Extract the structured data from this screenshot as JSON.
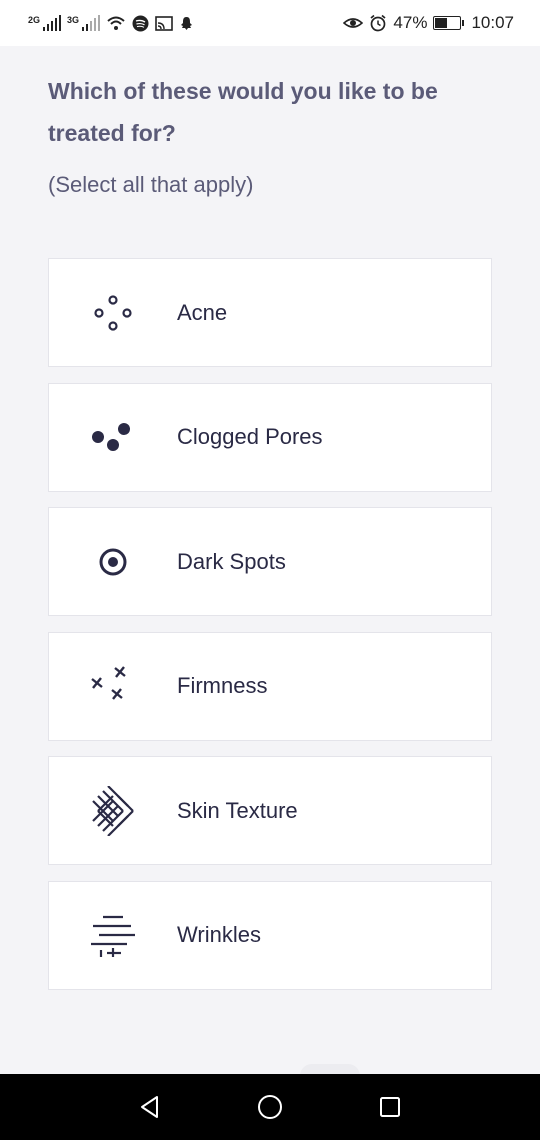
{
  "status_bar": {
    "network_1": "2G",
    "network_2": "3G",
    "battery_percent": "47%",
    "time": "10:07",
    "battery_level": 0.47
  },
  "question": {
    "title": "Which of these would you like to be treated for?",
    "hint": "(Select all that apply)"
  },
  "options": [
    {
      "label": "Acne",
      "icon": "acne-dots-icon"
    },
    {
      "label": "Clogged Pores",
      "icon": "clogged-pores-icon"
    },
    {
      "label": "Dark Spots",
      "icon": "target-icon"
    },
    {
      "label": "Firmness",
      "icon": "crosses-icon"
    },
    {
      "label": "Skin Texture",
      "icon": "crosshatch-icon"
    },
    {
      "label": "Wrinkles",
      "icon": "lines-icon"
    }
  ],
  "colors": {
    "background": "#f4f4f7",
    "card": "#ffffff",
    "card_border": "#e4e4ea",
    "text_primary": "#2a2a45",
    "text_secondary": "#5b5b78",
    "icon": "#2a2a45"
  }
}
